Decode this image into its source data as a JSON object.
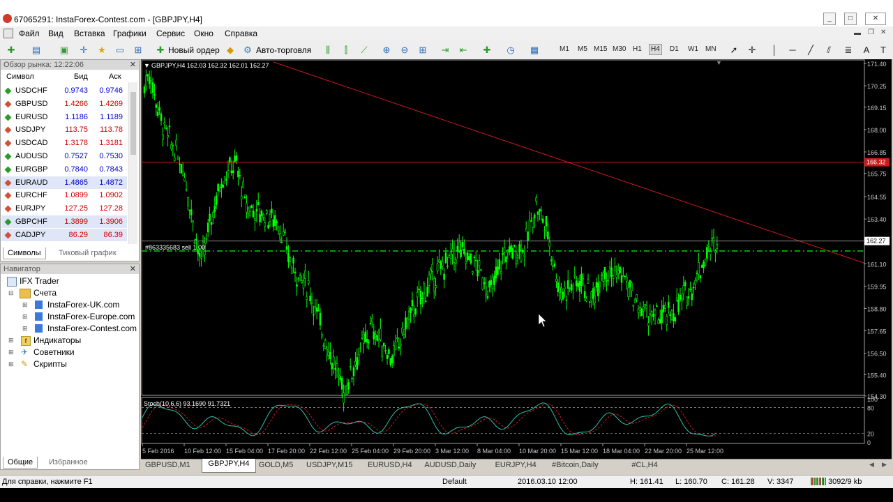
{
  "window": {
    "title": "67065291: InstaForex-Contest.com - [GBPJPY,H4]"
  },
  "menu": [
    "Файл",
    "Вид",
    "Вставка",
    "Графики",
    "Сервис",
    "Окно",
    "Справка"
  ],
  "toolbar": {
    "new_order": "Новый ордер",
    "autotrading": "Авто-торговля",
    "timeframes": [
      "M1",
      "M5",
      "M15",
      "M30",
      "H1",
      "H4",
      "D1",
      "W1",
      "MN"
    ],
    "active_timeframe": "H4"
  },
  "market_watch": {
    "header": "Обзор рынка: 12:22:06",
    "columns": {
      "symbol": "Символ",
      "bid": "Бид",
      "ask": "Аск"
    },
    "rows": [
      {
        "symbol": "USDCHF",
        "bid": "0.9743",
        "ask": "0.9746",
        "dir": "up",
        "color": "#0000cc"
      },
      {
        "symbol": "GBPUSD",
        "bid": "1.4266",
        "ask": "1.4269",
        "dir": "down",
        "color": "#cc0000"
      },
      {
        "symbol": "EURUSD",
        "bid": "1.1186",
        "ask": "1.1189",
        "dir": "up",
        "color": "#0000cc"
      },
      {
        "symbol": "USDJPY",
        "bid": "113.75",
        "ask": "113.78",
        "dir": "down",
        "color": "#cc0000"
      },
      {
        "symbol": "USDCAD",
        "bid": "1.3178",
        "ask": "1.3181",
        "dir": "down",
        "color": "#cc0000"
      },
      {
        "symbol": "AUDUSD",
        "bid": "0.7527",
        "ask": "0.7530",
        "dir": "up",
        "color": "#0000cc"
      },
      {
        "symbol": "EURGBP",
        "bid": "0.7840",
        "ask": "0.7843",
        "dir": "up",
        "color": "#0000cc"
      },
      {
        "symbol": "EURAUD",
        "bid": "1.4865",
        "ask": "1.4872",
        "dir": "down",
        "color": "#0000cc",
        "highlight": true
      },
      {
        "symbol": "EURCHF",
        "bid": "1.0899",
        "ask": "1.0902",
        "dir": "down",
        "color": "#cc0000"
      },
      {
        "symbol": "EURJPY",
        "bid": "127.25",
        "ask": "127.28",
        "dir": "down",
        "color": "#cc0000"
      },
      {
        "symbol": "GBPCHF",
        "bid": "1.3899",
        "ask": "1.3906",
        "dir": "up",
        "color": "#cc0000",
        "highlight": true
      },
      {
        "symbol": "CADJPY",
        "bid": "86.29",
        "ask": "86.39",
        "dir": "down",
        "color": "#cc0000",
        "highlight": true
      }
    ],
    "tabs": [
      "Символы",
      "Тиковый график"
    ]
  },
  "navigator": {
    "header": "Навигатор",
    "root": "IFX Trader",
    "accounts_label": "Счета",
    "accounts": [
      "InstaForex-UK.com",
      "InstaForex-Europe.com",
      "InstaForex-Contest.com"
    ],
    "groups": [
      "Индикаторы",
      "Советники",
      "Скрипты"
    ],
    "tabs": [
      "Общие",
      "Избранное"
    ]
  },
  "chart": {
    "header": "GBPJPY,H4  162.03 162.32 162.01 162.27",
    "order_label": "#863335683 sell 1.00",
    "stoch_label": "Stoch(10,6,6) 93.1690 91.7321",
    "price_ticks": [
      "171.40",
      "170.25",
      "169.15",
      "168.00",
      "166.85",
      "165.75",
      "164.55",
      "163.40",
      "162.27",
      "161.10",
      "159.95",
      "158.80",
      "157.65",
      "156.50",
      "155.40",
      "154.30"
    ],
    "red_price_tag": "166.32",
    "current_price_tag": "162.27",
    "stoch_ticks": [
      "100",
      "80",
      "20",
      "0"
    ],
    "time_ticks": [
      "5 Feb 2016",
      "10 Feb 12:00",
      "15 Feb 04:00",
      "17 Feb 20:00",
      "22 Feb 12:00",
      "25 Feb 04:00",
      "29 Feb 20:00",
      "3 Mar 12:00",
      "8 Mar 04:00",
      "10 Mar 20:00",
      "15 Mar 12:00",
      "18 Mar 04:00",
      "22 Mar 20:00",
      "25 Mar 12:00"
    ],
    "candle_color": "#00ff00",
    "bg_color": "#000000"
  },
  "chart_tabs": [
    "GBPUSD,M1",
    "GBPJPY,H4",
    "GOLD,M5",
    "USDJPY,M15",
    "EURUSD,H4",
    "AUDUSD,Daily",
    "EURJPY,H4",
    "#Bitcoin,Daily",
    "#CL,H4"
  ],
  "active_chart_tab": "GBPJPY,H4",
  "status": {
    "help": "Для справки, нажмите F1",
    "profile": "Default",
    "datetime": "2016.03.10 12:00",
    "high": "H: 161.41",
    "low": "L: 160.70",
    "close": "C: 161.28",
    "volume": "V: 3347",
    "traffic": "3092/9 kb"
  }
}
